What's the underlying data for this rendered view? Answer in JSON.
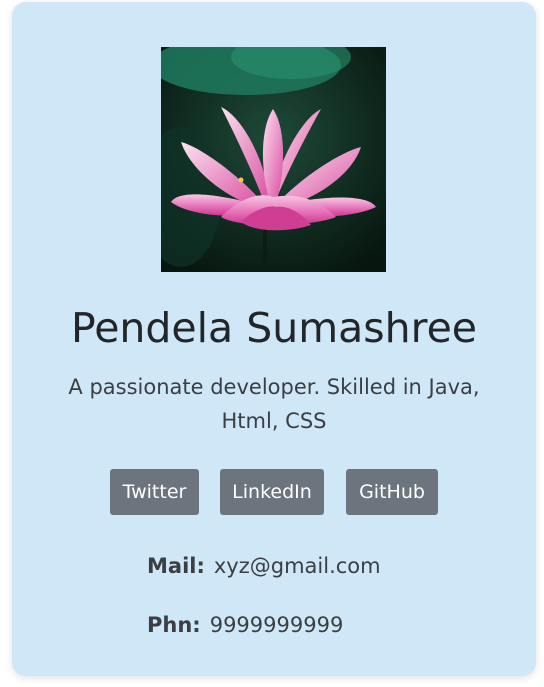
{
  "profile": {
    "photo_icon": "lotus-flower-photo",
    "name": "Pendela Sumashree",
    "bio": "A passionate developer. Skilled in Java, Html, CSS"
  },
  "social": {
    "twitter_label": "Twitter",
    "linkedin_label": "LinkedIn",
    "github_label": "GitHub"
  },
  "contact": {
    "mail_label": "Mail:",
    "mail_value": "xyz@gmail.com",
    "phone_label": "Phn:",
    "phone_value": "9999999999"
  },
  "colors": {
    "card_background": "#cfe7f6",
    "button_background": "#6c757d",
    "button_text": "#ffffff"
  }
}
